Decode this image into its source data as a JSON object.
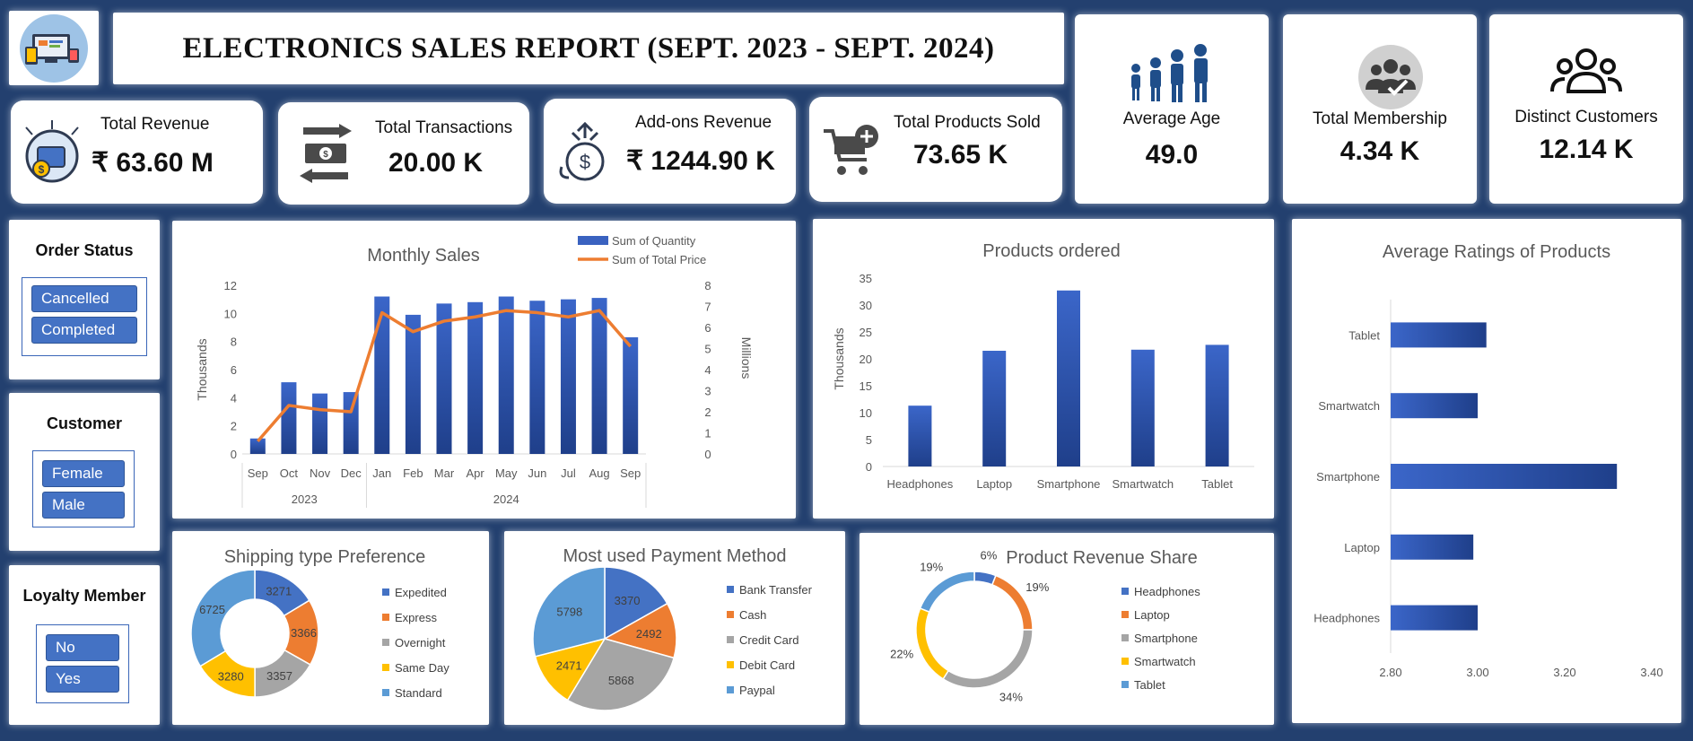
{
  "title": "ELECTRONICS SALES REPORT (SEPT. 2023 - SEPT. 2024)",
  "kpis": {
    "revenue": {
      "label": "Total Revenue",
      "value": "₹ 63.60 M"
    },
    "transactions": {
      "label": "Total Transactions",
      "value": "20.00 K"
    },
    "addons": {
      "label": "Add-ons Revenue",
      "value": "₹ 1244.90 K"
    },
    "products": {
      "label": "Total Products Sold",
      "value": "73.65 K"
    },
    "age": {
      "label": "Average Age",
      "value": "49.0"
    },
    "membership": {
      "label": "Total Membership",
      "value": "4.34 K"
    },
    "customers": {
      "label": "Distinct Customers",
      "value": "12.14 K"
    }
  },
  "slicers": {
    "order_status": {
      "title": "Order Status",
      "items": [
        "Cancelled",
        "Completed"
      ]
    },
    "customer": {
      "title": "Customer",
      "items": [
        "Female",
        "Male"
      ]
    },
    "loyalty": {
      "title": "Loyalty Member",
      "items": [
        "No",
        "Yes"
      ]
    }
  },
  "colors": {
    "bar": "#3a62c0",
    "line": "#ed7d31",
    "blue": "#4472c4",
    "orange": "#ed7d31",
    "gray": "#a5a5a5",
    "yellow": "#ffc000",
    "lightblue": "#5b9bd5"
  },
  "chart_data": [
    {
      "id": "monthly",
      "type": "bar",
      "title": "Monthly Sales",
      "categories": [
        "Sep",
        "Oct",
        "Nov",
        "Dec",
        "Jan",
        "Feb",
        "Mar",
        "Apr",
        "May",
        "Jun",
        "Jul",
        "Aug",
        "Sep"
      ],
      "groups": [
        {
          "label": "2023",
          "span": 4
        },
        {
          "label": "2024",
          "span": 9
        }
      ],
      "series": [
        {
          "name": "Sum of Quantity",
          "type": "bar",
          "axis": "left",
          "values": [
            1.1,
            5.1,
            4.3,
            4.4,
            11.2,
            9.9,
            10.7,
            10.8,
            11.2,
            10.9,
            11.0,
            11.1,
            8.3
          ]
        },
        {
          "name": "Sum of Total Price",
          "type": "line",
          "axis": "right",
          "values": [
            0.6,
            2.3,
            2.1,
            2.0,
            6.7,
            5.8,
            6.3,
            6.5,
            6.8,
            6.7,
            6.5,
            6.8,
            5.1
          ]
        }
      ],
      "ylabel": "Thousands",
      "y2label": "Millions",
      "ylim": [
        0,
        12
      ],
      "y2lim": [
        0,
        8
      ],
      "yticks": [
        "0",
        "2",
        "4",
        "6",
        "8",
        "10",
        "12"
      ],
      "y2ticks": [
        "0",
        "1",
        "2",
        "3",
        "4",
        "5",
        "6",
        "7",
        "8"
      ],
      "legend": "top-right"
    },
    {
      "id": "products",
      "type": "bar",
      "title": "Products ordered",
      "categories": [
        "Headphones",
        "Laptop",
        "Smartphone",
        "Smartwatch",
        "Tablet"
      ],
      "values": [
        11.3,
        21.5,
        32.7,
        21.7,
        22.6
      ],
      "ylabel": "Thousands",
      "ylim": [
        0,
        35
      ],
      "yticks": [
        "0",
        "5",
        "10",
        "15",
        "20",
        "25",
        "30",
        "35"
      ]
    },
    {
      "id": "ratings",
      "type": "bar",
      "orientation": "horizontal",
      "title": "Average Ratings of Products",
      "categories": [
        "Tablet",
        "Smartwatch",
        "Smartphone",
        "Laptop",
        "Headphones"
      ],
      "values": [
        3.02,
        3.0,
        3.32,
        2.99,
        3.0
      ],
      "xlim": [
        2.8,
        3.4
      ],
      "xticks": [
        "2.80",
        "3.00",
        "3.20",
        "3.40"
      ]
    },
    {
      "id": "shipping",
      "type": "pie",
      "donut": true,
      "title": "Shipping type Preference",
      "labels": [
        "Expedited",
        "Express",
        "Overnight",
        "Same Day",
        "Standard"
      ],
      "values": [
        3271,
        3366,
        3357,
        3280,
        6725
      ],
      "value_labels": [
        "3271",
        "3366",
        "3357",
        "3280",
        "6725"
      ]
    },
    {
      "id": "payment",
      "type": "pie",
      "title": "Most used Payment Method",
      "labels": [
        "Bank Transfer",
        "Cash",
        "Credit Card",
        "Debit Card",
        "Paypal"
      ],
      "values": [
        3370,
        2492,
        5868,
        2471,
        5798
      ],
      "value_labels": [
        "3370",
        "2492",
        "5868",
        "2471",
        "5798"
      ]
    },
    {
      "id": "revshare",
      "type": "pie",
      "donut": true,
      "title": "Product Revenue Share",
      "labels": [
        "Headphones",
        "Laptop",
        "Smartphone",
        "Smartwatch",
        "Tablet"
      ],
      "values": [
        6,
        19,
        34,
        22,
        19
      ],
      "value_labels": [
        "6%",
        "19%",
        "34%",
        "22%",
        "19%"
      ]
    }
  ]
}
